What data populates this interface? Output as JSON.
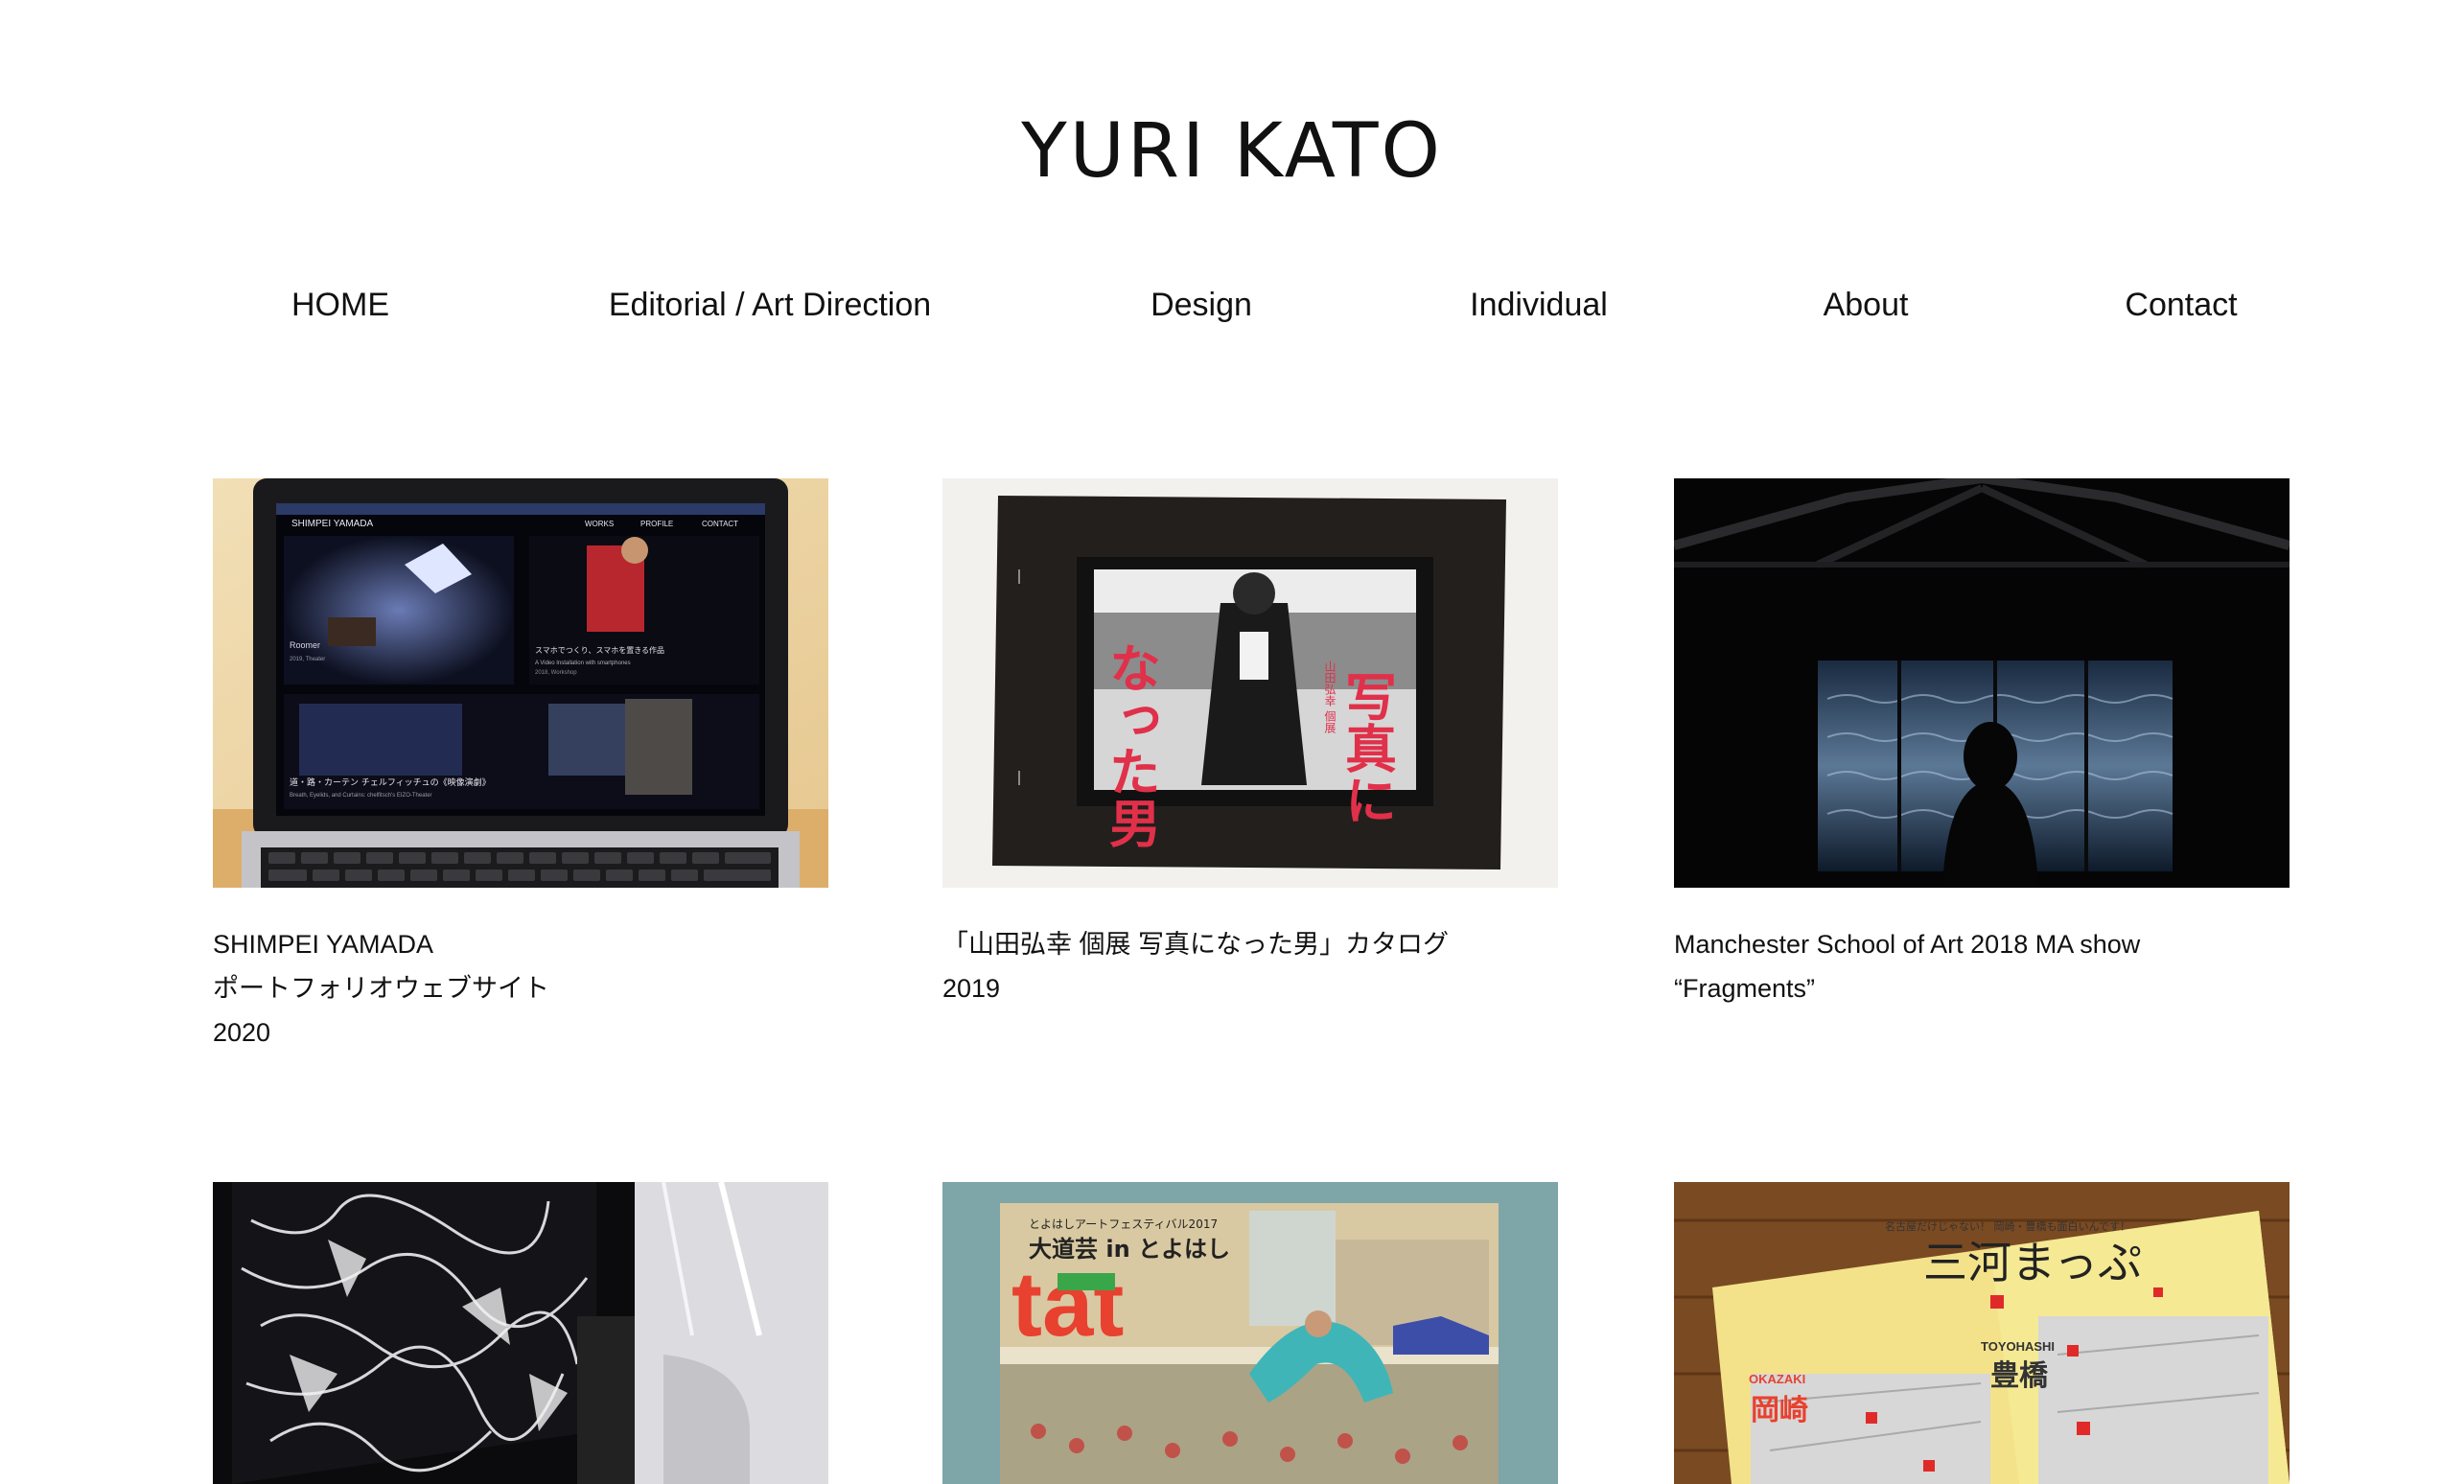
{
  "site": {
    "title": "YURI KATO"
  },
  "nav": {
    "items": [
      {
        "label": "HOME"
      },
      {
        "label": "Editorial / Art Direction"
      },
      {
        "label": "Design"
      },
      {
        "label": "Individual"
      },
      {
        "label": "About"
      },
      {
        "label": "Contact"
      }
    ]
  },
  "works": [
    {
      "title": "SHIMPEI YAMADA",
      "subtitle": "ポートフォリオウェブサイト",
      "year": "2020",
      "image": {
        "site_name": "SHIMPEI YAMADA",
        "menu": [
          "WORKS",
          "PROFILE",
          "CONTACT"
        ],
        "card_left": "Roomer",
        "card_left_sub": "2019, Theater",
        "card_right": "スマホでつくり、スマホを置きる作品",
        "card_right_sub": "A Video Installation with smartphones",
        "card_right_meta": "2018, Workshop",
        "card_bottom": "道・路・カーテン チェルフィッチュの《映像演劇》",
        "card_bottom_sub": "Breath, Eyelids, and Curtains: chelfitsch's EIZO-Theater"
      }
    },
    {
      "title": "「山田弘幸 個展 写真になった男」カタログ",
      "subtitle": "",
      "year": "2019",
      "image": {
        "poster_text_right": "写真に",
        "poster_text_left": "なった男",
        "poster_text_small": "山田弘幸 個展"
      }
    },
    {
      "title": "Manchester School of Art 2018 MA show",
      "subtitle": "“Fragments”",
      "year": "",
      "image": {}
    },
    {
      "title": "",
      "subtitle": "",
      "year": "",
      "image": {}
    },
    {
      "title": "",
      "subtitle": "",
      "year": "",
      "image": {
        "small": "とよはしアートフェスティバル2017",
        "headline": "大道芸 in とよはし",
        "logo": "tat"
      }
    },
    {
      "title": "",
      "subtitle": "",
      "year": "",
      "image": {
        "head": "名古屋だけじゃない！ 岡崎・豊橋も面白いんです！",
        "title": "三河まっぷ",
        "label1": "OKAZAKI",
        "kanji1": "岡崎",
        "label2": "TOYOHASHI",
        "kanji2": "豊橋"
      }
    }
  ],
  "colors": {
    "text": "#111111",
    "background": "#ffffff",
    "poster_red": "#e0304a",
    "tat_red": "#e8412f",
    "tat_green": "#3aa64a"
  }
}
